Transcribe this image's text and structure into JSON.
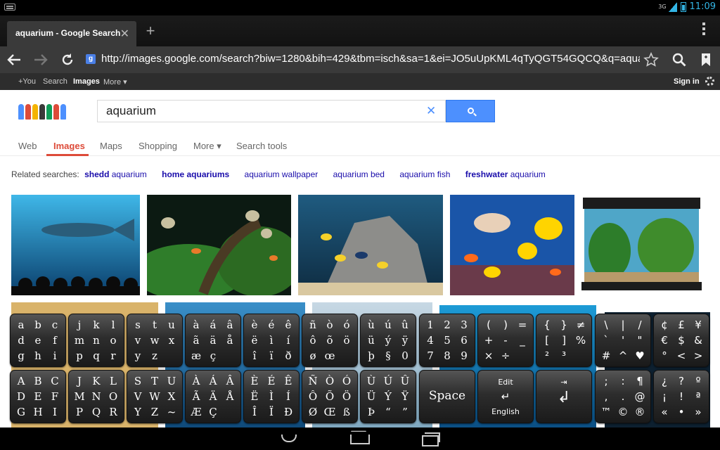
{
  "status_bar": {
    "network": "3G",
    "time": "11:09"
  },
  "browser": {
    "tab_title": "aquarium - Google Search",
    "close_tab_glyph": "✕",
    "new_tab_glyph": "+",
    "url": "http://images.google.com/search?biw=1280&bih=429&tbm=isch&sa=1&ei=JO5uUpKML4qTyQGT54GQCQ&q=aquarium",
    "favicon_letter": "g"
  },
  "google_bar": {
    "items": [
      "+You",
      "Search",
      "Images",
      "More ▾"
    ],
    "sign_in": "Sign in"
  },
  "search": {
    "query": "aquarium",
    "clear_glyph": "✕"
  },
  "nav_tabs": [
    "Web",
    "Images",
    "Maps",
    "Shopping",
    "More ▾",
    "Search tools"
  ],
  "related": {
    "label": "Related searches:",
    "items": [
      {
        "bold": "shedd",
        "rest": " aquarium"
      },
      {
        "bold": "home aquariums",
        "rest": ""
      },
      {
        "bold": "",
        "rest": "aquarium wallpaper",
        "bold2": ""
      },
      {
        "bold": "",
        "rest": "aquarium bed"
      },
      {
        "bold": "",
        "rest": "aquarium fish"
      },
      {
        "bold": "freshwater",
        "rest": " aquarium"
      }
    ],
    "plain": [
      "shedd aquarium",
      "home aquariums",
      "aquarium wallpaper",
      "aquarium bed",
      "aquarium fish",
      "freshwater aquarium"
    ]
  },
  "keyboard": {
    "row1": [
      [
        "a",
        "b",
        "c",
        "d",
        "e",
        "f",
        "g",
        "h",
        "i"
      ],
      [
        "j",
        "k",
        "l",
        "m",
        "n",
        "o",
        "p",
        "q",
        "r"
      ],
      [
        "s",
        "t",
        "u",
        "v",
        "w",
        "x",
        "y",
        "z",
        ""
      ],
      [
        "à",
        "á",
        "â",
        "ã",
        "ä",
        "å",
        "æ",
        "ç",
        ""
      ],
      [
        "è",
        "é",
        "ê",
        "ë",
        "ì",
        "í",
        "î",
        "ï",
        "ð"
      ],
      [
        "ñ",
        "ò",
        "ó",
        "ô",
        "õ",
        "ö",
        "ø",
        "œ",
        ""
      ],
      [
        "ù",
        "ú",
        "û",
        "ü",
        "ý",
        "ÿ",
        "þ",
        "§",
        "0"
      ],
      [
        "1",
        "2",
        "3",
        "4",
        "5",
        "6",
        "7",
        "8",
        "9"
      ],
      [
        "(",
        ")",
        "=",
        "+",
        "-",
        "_",
        "×",
        "÷",
        ""
      ],
      [
        "{",
        "}",
        "≠",
        "[",
        "]",
        "%",
        "²",
        "³",
        ""
      ],
      [
        "\\",
        "|",
        "/",
        "`",
        "'",
        "\"",
        "#",
        "^",
        "♥"
      ],
      [
        "¢",
        "£",
        "¥",
        "€",
        "$",
        "&",
        "°",
        "<",
        ">"
      ]
    ],
    "row2": [
      [
        "A",
        "B",
        "C",
        "D",
        "E",
        "F",
        "G",
        "H",
        "I"
      ],
      [
        "J",
        "K",
        "L",
        "M",
        "N",
        "O",
        "P",
        "Q",
        "R"
      ],
      [
        "S",
        "T",
        "U",
        "V",
        "W",
        "X",
        "Y",
        "Z",
        "~"
      ],
      [
        "À",
        "Á",
        "Â",
        "Ã",
        "Ä",
        "Å",
        "Æ",
        "Ç",
        ""
      ],
      [
        "È",
        "É",
        "Ê",
        "Ë",
        "Ì",
        "Í",
        "Î",
        "Ï",
        "Đ"
      ],
      [
        "Ñ",
        "Ò",
        "Ó",
        "Ô",
        "Õ",
        "Ö",
        "Ø",
        "Œ",
        "ß"
      ],
      [
        "Ù",
        "Ú",
        "Û",
        "Ü",
        "Ý",
        "Ÿ",
        "Þ",
        "“",
        "”"
      ]
    ],
    "row2_tail": [
      [
        ";",
        ":",
        "¶",
        ",",
        ".",
        "@",
        "™",
        "©",
        "®"
      ],
      [
        "¿",
        "?",
        "º",
        "¡",
        "!",
        "ª",
        "«",
        "•",
        "»"
      ]
    ],
    "space_label": "Space",
    "edit_label": "Edit",
    "lang_label": "English",
    "tab_glyph": "⇥",
    "enter_glyph": "↲",
    "edit_glyph": "↵"
  },
  "colors": {
    "accent": "#33b5e5",
    "google_red": "#dd4b39",
    "google_blue": "#4d90fe",
    "link": "#1a0dab"
  }
}
